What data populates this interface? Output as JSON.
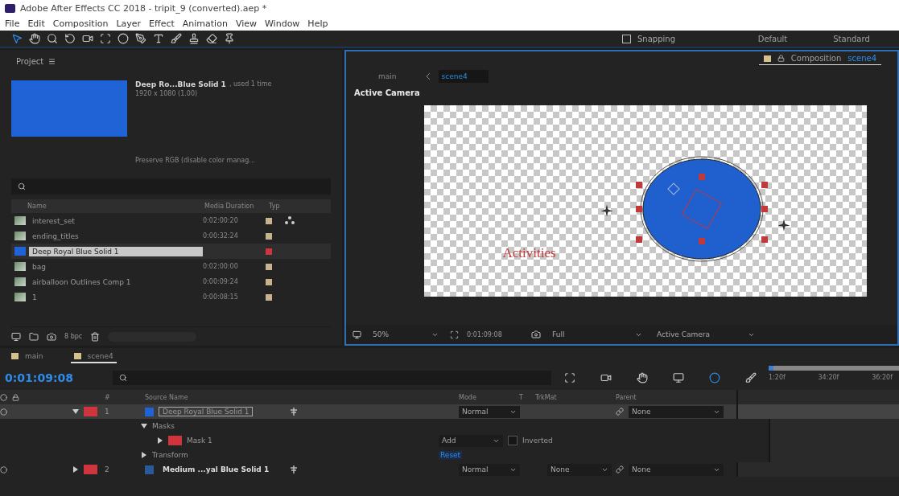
{
  "window": {
    "title": "Adobe After Effects CC 2018 - tripit_9 (converted).aep *"
  },
  "menu": [
    "File",
    "Edit",
    "Composition",
    "Layer",
    "Effect",
    "Animation",
    "View",
    "Window",
    "Help"
  ],
  "toolbar": {
    "snapping": {
      "label": "Snapping",
      "checked": false
    },
    "workspaces": [
      "Default",
      "Standard"
    ]
  },
  "project": {
    "title": "Project",
    "preview": {
      "name": "Deep Ro...Blue Solid 1",
      "usage": ", used 1 time",
      "size": "1920 x 1080 (1.00)",
      "color": "#1f63d6",
      "note": "Preserve RGB (disable color manag..."
    },
    "columns": [
      "Name",
      "Media Duration",
      "Typ"
    ],
    "items": [
      {
        "kind": "comp",
        "name": "interest_set",
        "duration": "0:02:00:20",
        "color": "#c8b48c",
        "selected": false
      },
      {
        "kind": "comp",
        "name": "ending_titles",
        "duration": "0:00:32:24",
        "color": "#c8b48c",
        "selected": false
      },
      {
        "kind": "solid",
        "name": "Deep Royal Blue Solid 1",
        "color": "#d0343c",
        "selected": true
      },
      {
        "kind": "comp",
        "name": "bag",
        "duration": "0:02:00:00",
        "color": "#c8b48c",
        "selected": false
      },
      {
        "kind": "comp",
        "name": "airballoon Outlines Comp 1",
        "duration": "0:00:09:24",
        "color": "#c8b48c",
        "selected": false
      },
      {
        "kind": "comp",
        "name": "1",
        "duration": "0:00:08:15",
        "color": "#c8b48c",
        "selected": false
      }
    ],
    "bpc": "8 bpc"
  },
  "composition": {
    "tab": "Composition",
    "name": "scene4",
    "breadcrumb": [
      "main",
      "scene4"
    ],
    "view": "Active Camera",
    "canvas_text": "Activities",
    "footer": {
      "zoom": "50%",
      "time": "0:01:09:08",
      "resolution": "Full",
      "camera": "Active Camera"
    }
  },
  "timeline": {
    "tabs": [
      {
        "label": "main",
        "selected": false
      },
      {
        "label": "scene4",
        "selected": true
      }
    ],
    "current_time": "0:01:09:08",
    "ruler": [
      "1:20f",
      "34:20f",
      "36:20f"
    ],
    "columns": {
      "number": "#",
      "source": "Source Name",
      "mode": "Mode",
      "t": "T",
      "trkmat": "TrkMat",
      "parent": "Parent"
    },
    "rows": [
      {
        "kind": "layer",
        "index": "1",
        "name": "Deep Royal Blue Solid 1",
        "color": "#d0343c",
        "source": {
          "color": "#1f63d6"
        },
        "expanded": true,
        "selected": true,
        "mode": "Normal",
        "parent": "None"
      },
      {
        "kind": "group",
        "label": "Masks",
        "expanded": true
      },
      {
        "kind": "mask",
        "label": "Mask 1",
        "color": "#d0343c",
        "mode": "Add",
        "inverted_label": "Inverted",
        "inverted": false
      },
      {
        "kind": "group",
        "label": "Transform",
        "expanded": false,
        "action": "Reset"
      },
      {
        "kind": "layer",
        "index": "2",
        "name": "Medium ...yal Blue Solid 1",
        "color": "#d0343c",
        "source": {
          "color": "#2a5a9a"
        },
        "expanded": false,
        "selected": false,
        "mode": "Normal",
        "trkmat": "None",
        "parent": "None"
      }
    ]
  }
}
